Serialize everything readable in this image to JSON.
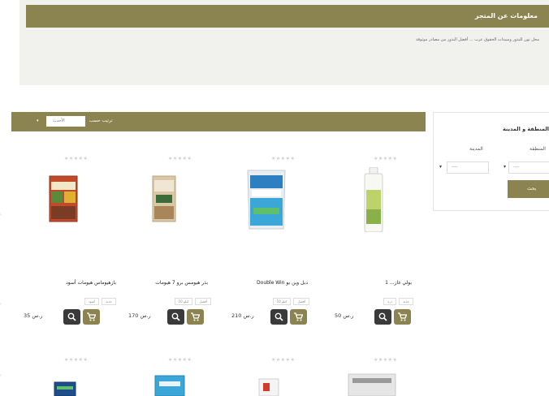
{
  "store_info": {
    "title": "معلومات عن المتجر",
    "description": "محل نون للبذور ومبيدات الحقوق عرب ... أفضل البذور من مصادر موثوقة"
  },
  "filter": {
    "title": "المنطقة و المدينة",
    "region_label": "المنطقة",
    "city_label": "المدينة",
    "region_value": "----",
    "city_value": "----",
    "button_label": "بحث"
  },
  "toolbar": {
    "sort_label": "ترتيب حسب",
    "sort_value": "الأحدث"
  },
  "products": [
    {
      "name": "بولي غاز... 1",
      "tag1": "جديد",
      "tag2": "ذرة",
      "price": "50 ر.س",
      "stars": "★★★★★"
    },
    {
      "name": "دبل وين بو Double Win",
      "tag1": "أفضل",
      "tag2": "10 كيلو",
      "price": "210 ر.س",
      "stars": "★★★★★"
    },
    {
      "name": "بذر هيومس برو 7 هيومات",
      "tag1": "أفضل",
      "tag2": "10 كيلو",
      "price": "170 ر.س",
      "stars": "★★★★★"
    },
    {
      "name": "بازهيوماس هيومات أسود",
      "tag1": "جديد",
      "tag2": "أسود",
      "price": "35 ر.س",
      "stars": "★★★★★"
    }
  ],
  "second_row_stars": [
    "★★★★★",
    "★★★★★",
    "★★★★★",
    "★★★★★"
  ],
  "icons": {
    "cart": "cart-icon",
    "zoom": "search-icon",
    "caret": "chevron-down-icon"
  },
  "colors": {
    "accent": "#8c8450",
    "dark_button": "#3a3a3a",
    "panel_bg": "#f1f1ee"
  }
}
